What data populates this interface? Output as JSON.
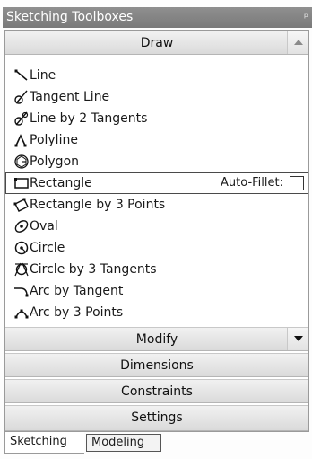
{
  "panel": {
    "title": "Sketching Toolboxes",
    "pin_glyph": "ᵖ"
  },
  "sections": {
    "draw": "Draw",
    "modify": "Modify",
    "dimensions": "Dimensions",
    "constraints": "Constraints",
    "settings": "Settings"
  },
  "draw_tools": [
    {
      "label": "Line",
      "icon": "line-icon"
    },
    {
      "label": "Tangent Line",
      "icon": "tangent-line-icon"
    },
    {
      "label": "Line by 2 Tangents",
      "icon": "line-by-2-tangents-icon"
    },
    {
      "label": "Polyline",
      "icon": "polyline-icon"
    },
    {
      "label": "Polygon",
      "icon": "polygon-icon"
    },
    {
      "label": "Rectangle",
      "icon": "rectangle-icon"
    },
    {
      "label": "Rectangle by 3 Points",
      "icon": "rectangle-by-3-points-icon"
    },
    {
      "label": "Oval",
      "icon": "oval-icon"
    },
    {
      "label": "Circle",
      "icon": "circle-icon"
    },
    {
      "label": "Circle by 3 Tangents",
      "icon": "circle-by-3-tangents-icon"
    },
    {
      "label": "Arc by Tangent",
      "icon": "arc-by-tangent-icon"
    },
    {
      "label": "Arc by 3 Points",
      "icon": "arc-by-3-points-icon"
    }
  ],
  "rectangle_options": {
    "auto_fillet_label": "Auto-Fillet:",
    "auto_fillet_checked": false
  },
  "tabs": {
    "sketching": "Sketching",
    "modeling": "Modeling"
  }
}
